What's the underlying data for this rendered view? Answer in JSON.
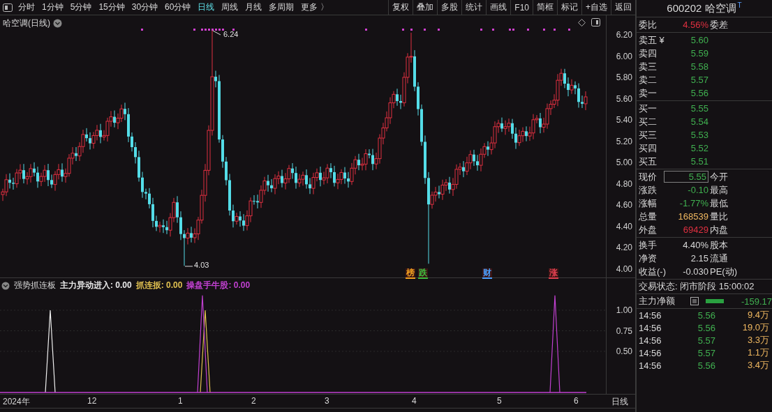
{
  "toolbar": {
    "periods": [
      {
        "label": "分时",
        "selected": false
      },
      {
        "label": "1分钟",
        "selected": false
      },
      {
        "label": "5分钟",
        "selected": false
      },
      {
        "label": "15分钟",
        "selected": false
      },
      {
        "label": "30分钟",
        "selected": false
      },
      {
        "label": "60分钟",
        "selected": false
      },
      {
        "label": "日线",
        "selected": true
      },
      {
        "label": "周线",
        "selected": false
      },
      {
        "label": "月线",
        "selected": false
      },
      {
        "label": "多周期",
        "selected": false
      },
      {
        "label": "更多 〉",
        "selected": false
      }
    ],
    "actions": [
      "复权",
      "叠加",
      "多股",
      "统计",
      "画线",
      "F10",
      "简框",
      "标记",
      "+自选",
      "返回"
    ]
  },
  "chart": {
    "title": "哈空调(日线)",
    "price_ticks": [
      "6.20",
      "6.00",
      "5.80",
      "5.60",
      "5.40",
      "5.20",
      "5.00",
      "4.80",
      "4.60",
      "4.40",
      "4.20",
      "4.00"
    ],
    "high_label": "6.24",
    "low_label": "4.03",
    "event_tags": [
      {
        "label": "榜",
        "color": "#f0a020"
      },
      {
        "label": "跌",
        "color": "#40c040"
      },
      {
        "label": "财",
        "color": "#4aa0ff"
      },
      {
        "label": "涨",
        "color": "#e04050"
      }
    ]
  },
  "indicator": {
    "name": "强势抓连板",
    "values": [
      {
        "text": "主力异动进入: 0.00",
        "color": "#e8e8e8"
      },
      {
        "text": "抓连扳: 0.00",
        "color": "#e0c050"
      },
      {
        "text": "操盘手牛股: 0.00",
        "color": "#c040d0"
      }
    ],
    "ticks": [
      "1.00",
      "0.75",
      "0.50"
    ]
  },
  "x_axis": {
    "labels": [
      "2024年",
      "12",
      "1",
      "2",
      "3",
      "4",
      "5",
      "6"
    ],
    "period": "日线"
  },
  "quote": {
    "code": "600202",
    "name": "哈空调",
    "badge": "T",
    "ratio": {
      "label": "委比",
      "value": "4.56%",
      "label2": "委差"
    },
    "asks": [
      {
        "label": "卖五 ¥",
        "price": "5.60"
      },
      {
        "label": "卖四",
        "price": "5.59"
      },
      {
        "label": "卖三",
        "price": "5.58"
      },
      {
        "label": "卖二",
        "price": "5.57"
      },
      {
        "label": "卖一",
        "price": "5.56"
      }
    ],
    "bids": [
      {
        "label": "买一",
        "price": "5.55"
      },
      {
        "label": "买二",
        "price": "5.54"
      },
      {
        "label": "买三",
        "price": "5.53"
      },
      {
        "label": "买四",
        "price": "5.52"
      },
      {
        "label": "买五",
        "price": "5.51"
      }
    ],
    "stats": [
      {
        "label": "现价",
        "value": "5.55",
        "label2": "今开",
        "color": "#40b050",
        "boxed": true
      },
      {
        "label": "涨跌",
        "value": "-0.10",
        "label2": "最高",
        "color": "#40b050",
        "boxed": false
      },
      {
        "label": "涨幅",
        "value": "-1.77%",
        "label2": "最低",
        "color": "#40b050",
        "boxed": false
      },
      {
        "label": "总量",
        "value": "168539",
        "label2": "量比",
        "color": "#f0b860",
        "boxed": false
      },
      {
        "label": "外盘",
        "value": "69429",
        "label2": "内盘",
        "color": "#e03040",
        "boxed": false
      }
    ],
    "stats2": [
      {
        "label": "换手",
        "value": "4.40%",
        "label2": "股本"
      },
      {
        "label": "净资",
        "value": "2.15",
        "label2": "流通"
      },
      {
        "label": "收益(-)",
        "value": "-0.030",
        "label2": "PE(动)"
      }
    ],
    "status": "交易状态: 闭市阶段 15:00:02",
    "net_flow": {
      "label": "主力净额",
      "value": "-159.17"
    },
    "trades": [
      {
        "time": "14:56",
        "price": "5.56",
        "volume": "9.4万"
      },
      {
        "time": "14:56",
        "price": "5.56",
        "volume": "19.0万"
      },
      {
        "time": "14:56",
        "price": "5.57",
        "volume": "3.3万"
      },
      {
        "time": "14:56",
        "price": "5.57",
        "volume": "1.1万"
      },
      {
        "time": "14:56",
        "price": "5.56",
        "volume": "3.4万"
      }
    ]
  }
}
